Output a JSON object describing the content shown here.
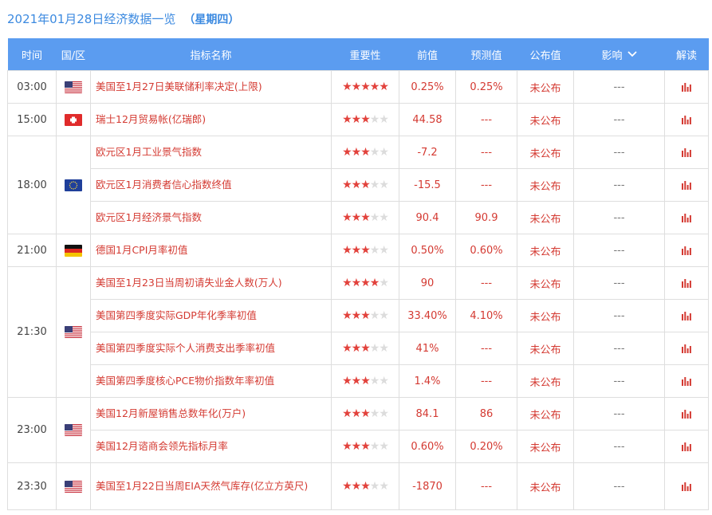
{
  "heading": {
    "date_title": "2021年01月28日经济数据一览",
    "weekday": "（星期四）"
  },
  "colors": {
    "header_bg": "#5b9cf0",
    "accent_red": "#d43a32",
    "title_blue": "#3c8ae0"
  },
  "columns": {
    "time": "时间",
    "region": "国/区",
    "indicator": "指标名称",
    "importance": "重要性",
    "previous": "前值",
    "forecast": "预测值",
    "actual": "公布值",
    "impact": "影响",
    "interpret": "解读"
  },
  "rows": [
    {
      "time": "03:00",
      "flag": "us-flag",
      "indicator": "美国至1月27日美联储利率决定(上限)",
      "stars": 5,
      "previous": "0.25%",
      "forecast": "0.25%",
      "actual": "未公布",
      "impact": "---"
    },
    {
      "time": "15:00",
      "flag": "switzerland-flag",
      "indicator": "瑞士12月贸易帐(亿瑞郎)",
      "stars": 3,
      "previous": "44.58",
      "forecast": "---",
      "actual": "未公布",
      "impact": "---"
    },
    {
      "time": "18:00",
      "flag": "eu-flag",
      "indicator": "欧元区1月工业景气指数",
      "stars": 3,
      "previous": "-7.2",
      "forecast": "---",
      "actual": "未公布",
      "impact": "---"
    },
    {
      "time": "18:00",
      "flag": "eu-flag",
      "indicator": "欧元区1月消费者信心指数终值",
      "stars": 3,
      "previous": "-15.5",
      "forecast": "---",
      "actual": "未公布",
      "impact": "---"
    },
    {
      "time": "18:00",
      "flag": "eu-flag",
      "indicator": "欧元区1月经济景气指数",
      "stars": 3,
      "previous": "90.4",
      "forecast": "90.9",
      "actual": "未公布",
      "impact": "---"
    },
    {
      "time": "21:00",
      "flag": "germany-flag",
      "indicator": "德国1月CPI月率初值",
      "stars": 3,
      "previous": "0.50%",
      "forecast": "0.60%",
      "actual": "未公布",
      "impact": "---"
    },
    {
      "time": "21:30",
      "flag": "us-flag",
      "indicator": "美国至1月23日当周初请失业金人数(万人)",
      "stars": 4,
      "previous": "90",
      "forecast": "---",
      "actual": "未公布",
      "impact": "---"
    },
    {
      "time": "21:30",
      "flag": "us-flag",
      "indicator": "美国第四季度实际GDP年化季率初值",
      "stars": 3,
      "previous": "33.40%",
      "forecast": "4.10%",
      "actual": "未公布",
      "impact": "---"
    },
    {
      "time": "21:30",
      "flag": "us-flag",
      "indicator": "美国第四季度实际个人消费支出季率初值",
      "stars": 3,
      "previous": "41%",
      "forecast": "---",
      "actual": "未公布",
      "impact": "---"
    },
    {
      "time": "21:30",
      "flag": "us-flag",
      "indicator": "美国第四季度核心PCE物价指数年率初值",
      "stars": 3,
      "previous": "1.4%",
      "forecast": "---",
      "actual": "未公布",
      "impact": "---"
    },
    {
      "time": "23:00",
      "flag": "us-flag",
      "indicator": "美国12月新屋销售总数年化(万户)",
      "stars": 3,
      "previous": "84.1",
      "forecast": "86",
      "actual": "未公布",
      "impact": "---"
    },
    {
      "time": "23:00",
      "flag": "us-flag",
      "indicator": "美国12月谘商会领先指标月率",
      "stars": 3,
      "previous": "0.60%",
      "forecast": "0.20%",
      "actual": "未公布",
      "impact": "---"
    },
    {
      "time": "23:30",
      "flag": "us-flag",
      "indicator": "美国至1月22日当周EIA天然气库存(亿立方英尺)",
      "stars": 3,
      "previous": "-1870",
      "forecast": "---",
      "actual": "未公布",
      "impact": "---"
    }
  ]
}
